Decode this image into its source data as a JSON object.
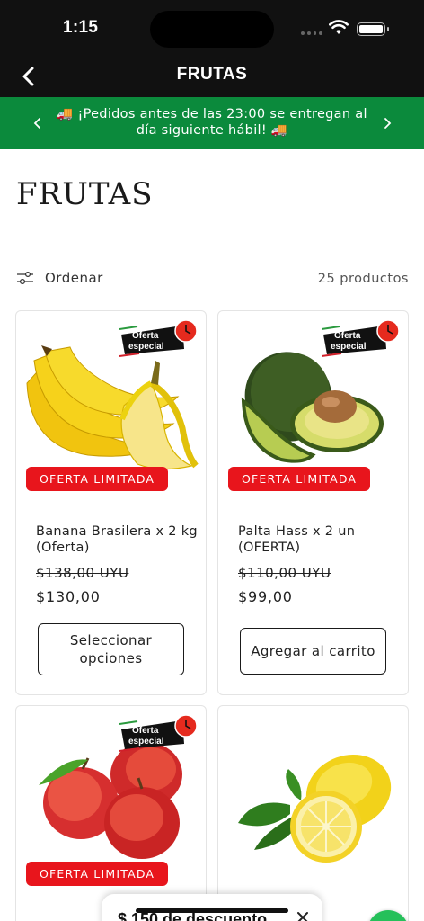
{
  "status_bar": {
    "time": "1:15"
  },
  "header": {
    "title": "FRUTAS",
    "back_icon": "chevron-left-icon"
  },
  "banner": {
    "text": "🚚 ¡Pedidos antes de las 23:00 se entregan al día siguiente hábil! 🚚",
    "prev_icon": "chevron-left-icon",
    "next_icon": "chevron-right-icon",
    "bg_color": "#0b8a3c"
  },
  "page_title": "FRUTAS",
  "toolbar": {
    "sort_label": "Ordenar",
    "product_count": "25 productos"
  },
  "products": [
    {
      "name": "Banana Brasilera x 2 kg (Oferta)",
      "old_price": "$138,00 UYU",
      "price": "$130,00",
      "badge": "OFERTA LIMITADA",
      "special_badge": "Oferta especial",
      "button": "Seleccionar opciones",
      "image": "banana"
    },
    {
      "name": "Palta Hass x 2 un (OFERTA)",
      "old_price": "$110,00 UYU",
      "price": "$99,00",
      "badge": "OFERTA LIMITADA",
      "special_badge": "Oferta especial",
      "button": "Agregar al carrito",
      "image": "avocado"
    },
    {
      "badge": "OFERTA LIMITADA",
      "special_badge": "Oferta especial",
      "image": "apple"
    },
    {
      "image": "lemon"
    }
  ],
  "discount_popup": {
    "text": "$ 150 de descuento",
    "close_icon": "close-icon"
  },
  "colors": {
    "sale_badge": "#e8151c",
    "header_bg": "#111111",
    "chat": "#25c05a"
  }
}
